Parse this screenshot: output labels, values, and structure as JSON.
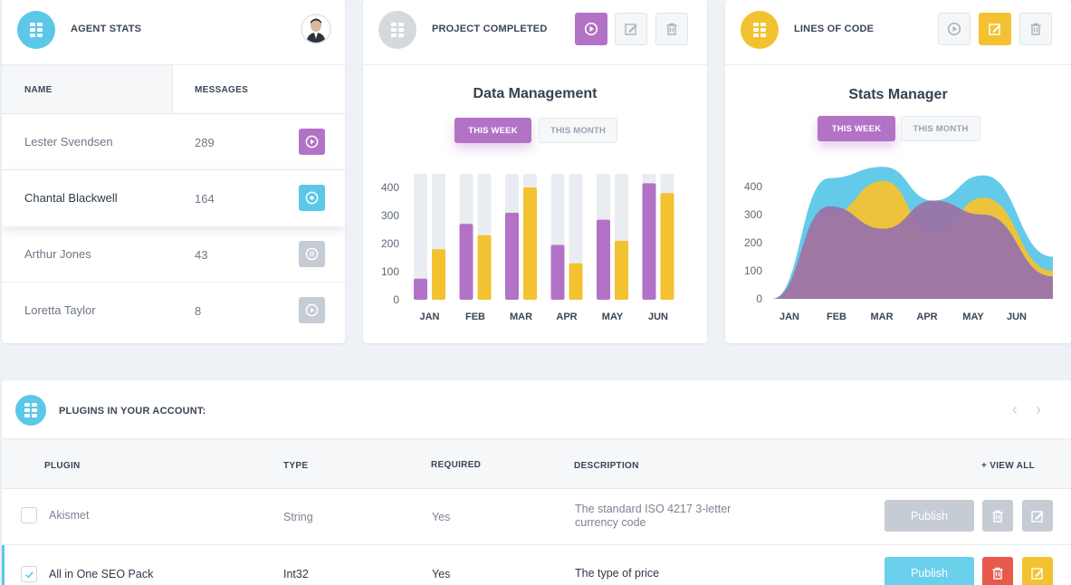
{
  "colors": {
    "cyan": "#5bc8e8",
    "purple": "#b273c6",
    "yellow": "#f3c230",
    "gray": "#c5ccd3",
    "red": "#e6594b"
  },
  "agent_card": {
    "title": "AGENT STATS",
    "col_name": "NAME",
    "col_messages": "MESSAGES",
    "rows": [
      {
        "name": "Lester Svendsen",
        "messages": "289",
        "icon": "play-circle-icon",
        "color": "#b273c6"
      },
      {
        "name": "Chantal Blackwell",
        "messages": "164",
        "icon": "stop-circle-icon",
        "color": "#5bc8e8"
      },
      {
        "name": "Arthur Jones",
        "messages": "43",
        "icon": "pause-circle-icon",
        "color": "#c5ccd3"
      },
      {
        "name": "Loretta Taylor",
        "messages": "8",
        "icon": "play-circle-icon",
        "color": "#c5ccd3"
      }
    ]
  },
  "project_card": {
    "title": "PROJECT COMPLETED",
    "chart_title": "Data Management",
    "toggle_week": "THIS WEEK",
    "toggle_month": "THIS MONTH"
  },
  "lines_card": {
    "title": "LINES OF CODE",
    "chart_title": "Stats Manager",
    "toggle_week": "THIS WEEK",
    "toggle_month": "THIS MONTH"
  },
  "chart_data": [
    {
      "type": "bar",
      "title": "Data Management",
      "categories": [
        "JAN",
        "FEB",
        "MAR",
        "APR",
        "MAY",
        "JUN"
      ],
      "yticks": [
        "0",
        "100",
        "200",
        "300",
        "400"
      ],
      "ylim": [
        0,
        400
      ],
      "series": [
        {
          "values": [
            75,
            270,
            310,
            195,
            285,
            415
          ],
          "color": "#b273c6"
        },
        {
          "values": [
            180,
            230,
            400,
            130,
            210,
            380
          ],
          "color": "#f3c230"
        }
      ],
      "background_max": 450,
      "grid": false
    },
    {
      "type": "area",
      "title": "Stats Manager",
      "categories": [
        "JAN",
        "FEB",
        "MAR",
        "APR",
        "MAY",
        "JUN"
      ],
      "yticks": [
        "0",
        "100",
        "200",
        "300",
        "400"
      ],
      "ylim": [
        0,
        400
      ],
      "series": [
        {
          "values": [
            0,
            430,
            470,
            350,
            440,
            150
          ],
          "color": "#5bc8e8"
        },
        {
          "values": [
            0,
            300,
            420,
            230,
            360,
            100
          ],
          "color": "#f3c230"
        },
        {
          "values": [
            0,
            330,
            250,
            350,
            300,
            80
          ],
          "color": "#9a73a9"
        }
      ],
      "grid": false
    }
  ],
  "plugins": {
    "title": "PLUGINS IN YOUR ACCOUNT:",
    "cols": {
      "plugin": "PLUGIN",
      "type": "TYPE",
      "required": "REQUIRED",
      "description": "DESCRIPTION",
      "view_all": "+ VIEW ALL"
    },
    "rows": [
      {
        "name": "Akismet",
        "type": "String",
        "required": "Yes",
        "description": "The standard ISO 4217 3-letter currency code",
        "checked": false,
        "publish": "Publish"
      },
      {
        "name": "All in One SEO Pack",
        "type": "Int32",
        "required": "Yes",
        "description": "The type of price",
        "checked": true,
        "publish": "Publish"
      }
    ]
  }
}
